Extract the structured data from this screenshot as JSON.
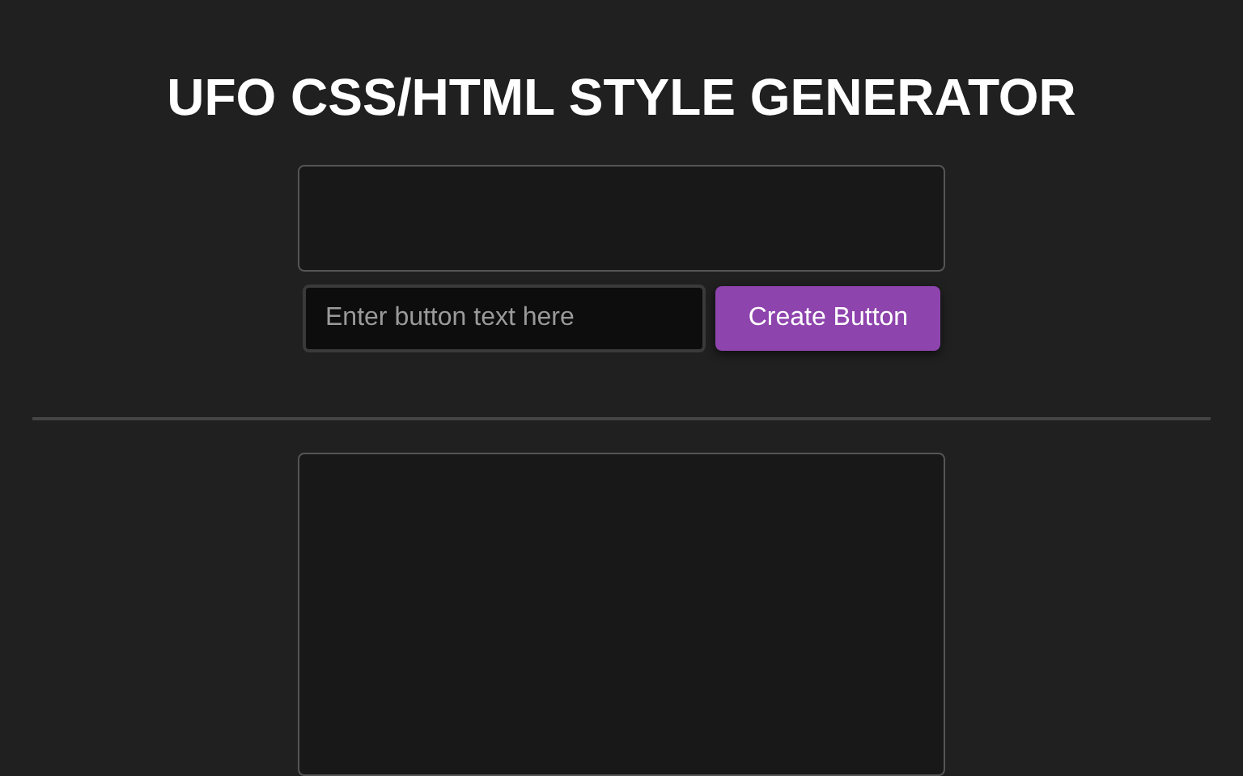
{
  "title": "UFO CSS/HTML STYLE GENERATOR",
  "input": {
    "placeholder": "Enter button text here"
  },
  "button": {
    "label": "Create Button"
  }
}
